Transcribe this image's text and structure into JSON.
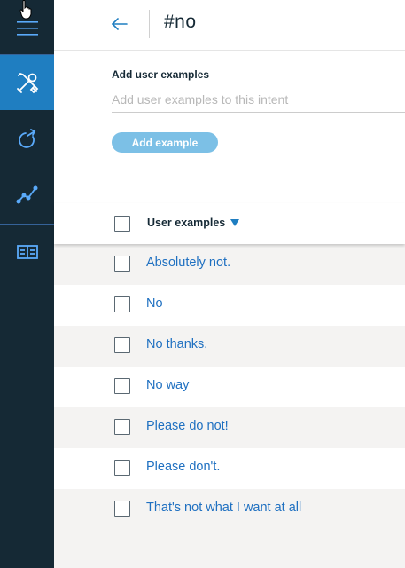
{
  "sidebar": {
    "items": [
      {
        "name": "menu",
        "icon": "hamburger-menu-icon"
      },
      {
        "name": "build",
        "icon": "tools-icon",
        "active": true
      },
      {
        "name": "improve",
        "icon": "refresh-circle-icon"
      },
      {
        "name": "analytics",
        "icon": "line-chart-icon"
      },
      {
        "name": "dashboard",
        "icon": "grid-layout-icon"
      }
    ],
    "accent_color": "#1f7ec1",
    "background_color": "#152935"
  },
  "header": {
    "back_icon": "arrow-left-icon",
    "title": "#no"
  },
  "form": {
    "label": "Add user examples",
    "input_placeholder": "Add user examples to this intent",
    "input_value": "",
    "button_label": "Add example"
  },
  "table": {
    "column_header": "User examples",
    "sort_icon": "sort-down-icon",
    "rows": [
      "Absolutely not.",
      "No",
      "No thanks.",
      "No way",
      "Please do not!",
      "Please don't.",
      "That's not what I want at all"
    ]
  }
}
